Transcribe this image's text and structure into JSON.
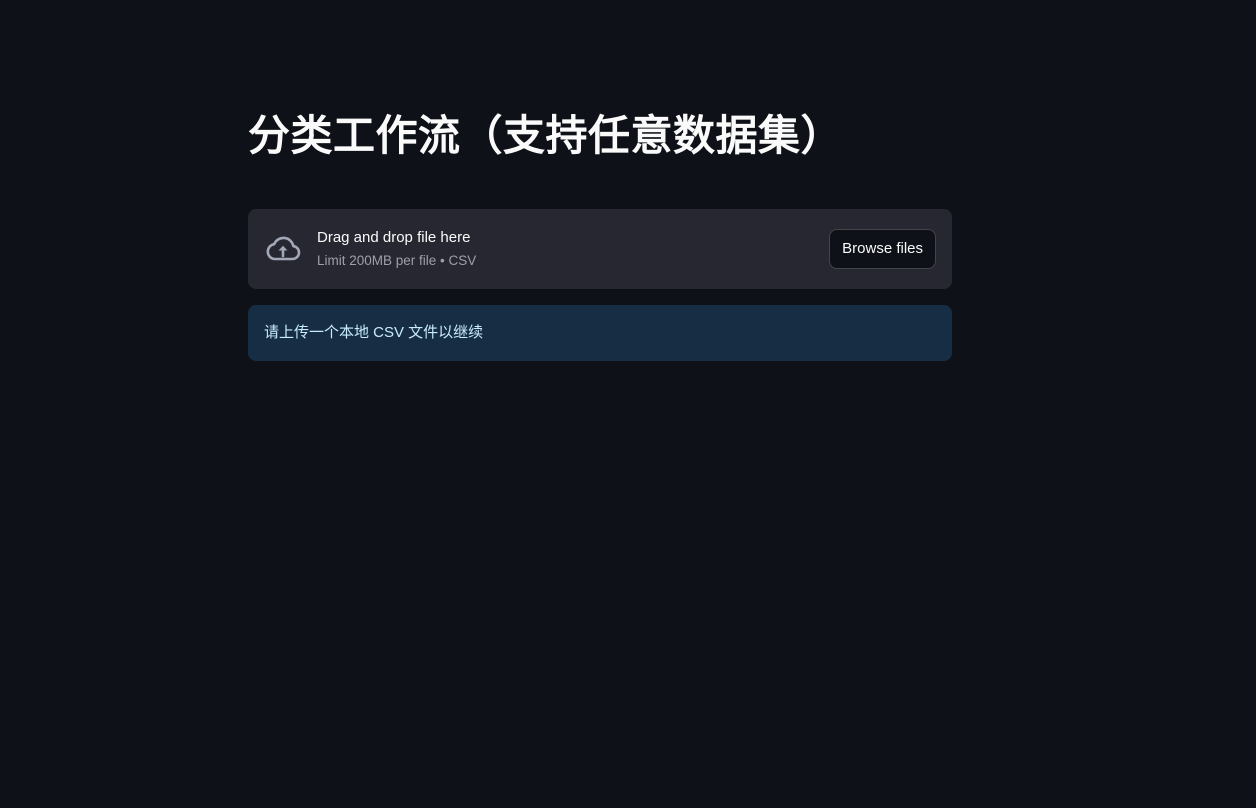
{
  "page": {
    "title": "分类工作流（支持任意数据集）"
  },
  "uploader": {
    "icon": "cloud-upload-icon",
    "primary_text": "Drag and drop file here",
    "secondary_text": "Limit 200MB per file • CSV",
    "browse_label": "Browse files"
  },
  "info": {
    "message": "请上传一个本地 CSV 文件以继续"
  },
  "colors": {
    "background": "#0e1117",
    "uploader_bg": "#262730",
    "info_bg": "#172d43",
    "info_text": "#c7ebff",
    "text_primary": "#fafafa",
    "text_secondary": "#9ea0a8"
  }
}
